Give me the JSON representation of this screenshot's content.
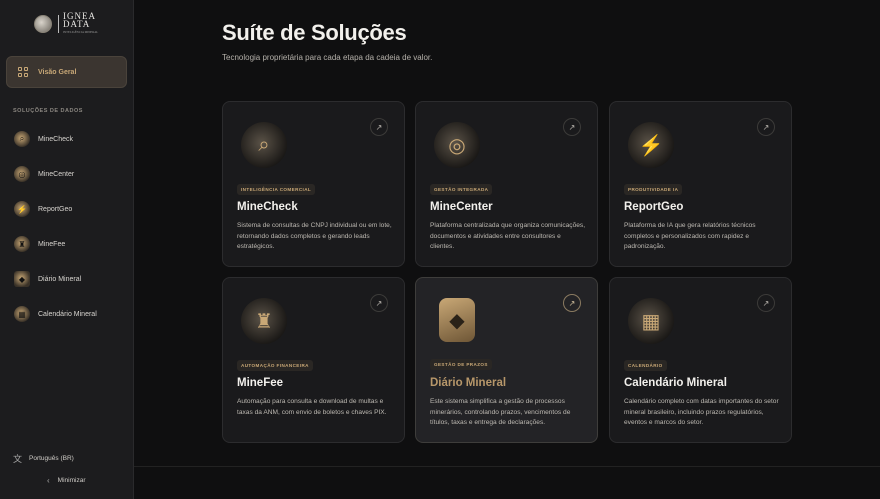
{
  "brand": {
    "name_line1": "IGNEA",
    "name_line2": "DATA",
    "tagline": "INTELIGÊNCIA MINERAL"
  },
  "sidebar": {
    "overview_label": "Visão Geral",
    "section_title": "SOLUÇÕES DE DADOS",
    "items": [
      {
        "label": "MineCheck",
        "icon": "magnifier-globe-icon"
      },
      {
        "label": "MineCenter",
        "icon": "ring-icon"
      },
      {
        "label": "ReportGeo",
        "icon": "bolt-globe-icon"
      },
      {
        "label": "MineFee",
        "icon": "lion-globe-icon"
      },
      {
        "label": "Diário Mineral",
        "icon": "shield-icon"
      },
      {
        "label": "Calendário Mineral",
        "icon": "calendar-globe-icon"
      }
    ],
    "language": "Português (BR)",
    "minimize": "Minimizar"
  },
  "main": {
    "title": "Suíte de Soluções",
    "subtitle": "Tecnologia proprietária para cada etapa da cadeia de valor.",
    "cards": [
      {
        "tag": "INTELIGÊNCIA COMERCIAL",
        "title": "MineCheck",
        "desc": "Sistema de consultas de CNPJ individual ou em lote, retornando dados completos e gerando leads estratégicos."
      },
      {
        "tag": "GESTÃO INTEGRADA",
        "title": "MineCenter",
        "desc": "Plataforma centralizada que organiza comunicações, documentos e atividades entre consultores e clientes."
      },
      {
        "tag": "PRODUTIVIDADE IA",
        "title": "ReportGeo",
        "desc": "Plataforma de IA que gera relatórios técnicos completos e personalizados com rapidez e padronização."
      },
      {
        "tag": "AUTOMAÇÃO FINANCEIRA",
        "title": "MineFee",
        "desc": "Automação para consulta e download de multas e taxas da ANM, com envio de boletos e chaves PIX."
      },
      {
        "tag": "GESTÃO DE PRAZOS",
        "title": "Diário Mineral",
        "desc": "Este sistema simplifica a gestão de processos minerários, controlando prazos, vencimentos de títulos, taxas e entrega de declarações."
      },
      {
        "tag": "CALENDÁRIO",
        "title": "Calendário Mineral",
        "desc": "Calendário completo com datas importantes do setor mineral brasileiro, incluindo prazos regulatórios, eventos e marcos do setor."
      }
    ]
  },
  "colors": {
    "accent": "#c9a876",
    "background": "#0f0f10",
    "sidebar": "#1c1c1e",
    "card": "#1a1a1c"
  }
}
